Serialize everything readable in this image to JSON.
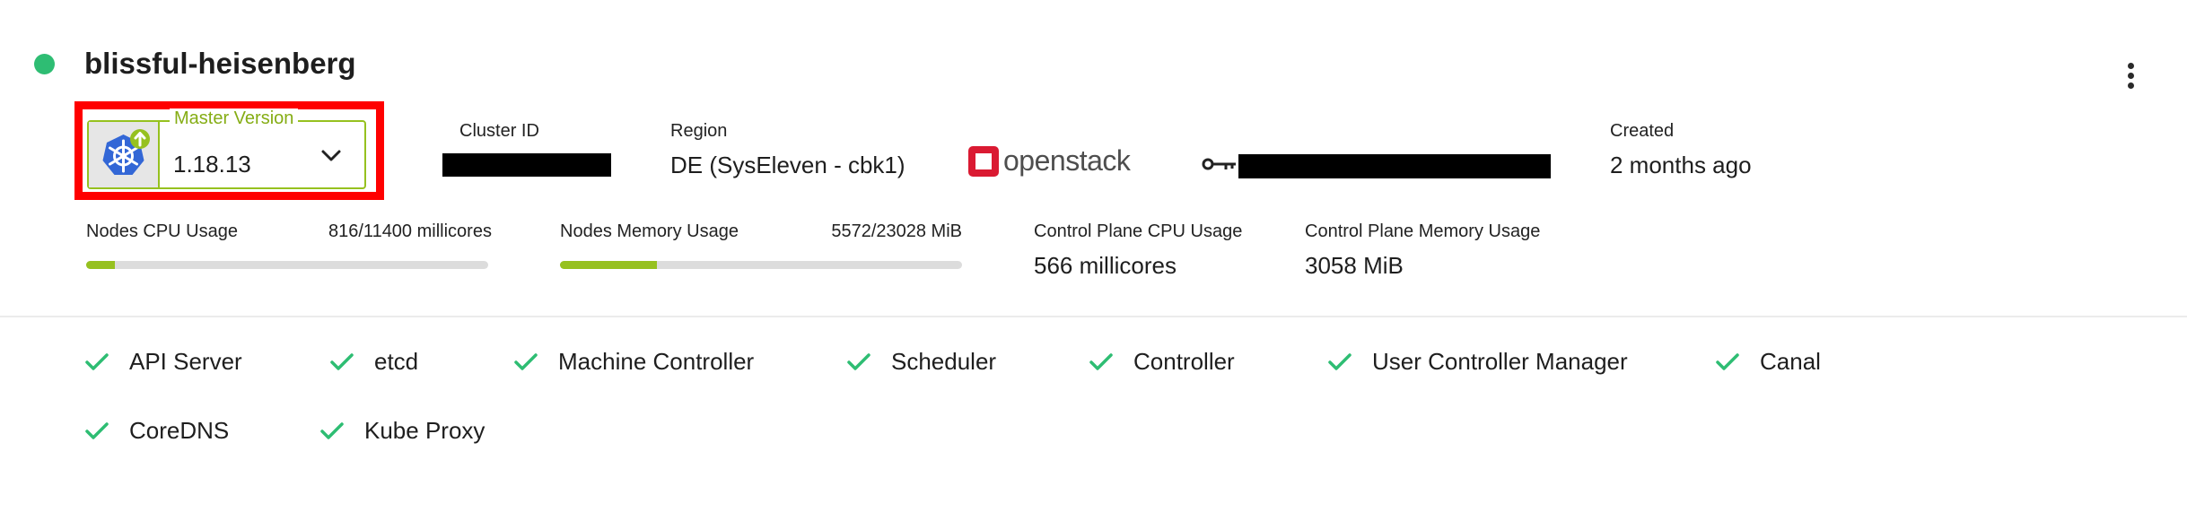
{
  "cluster": {
    "name": "blissful-heisenberg",
    "status_color": "#2ebd73"
  },
  "master_version": {
    "label": "Master Version",
    "value": "1.18.13"
  },
  "cluster_id": {
    "label": "Cluster ID"
  },
  "region": {
    "label": "Region",
    "value": "DE (SysEleven - cbk1)"
  },
  "provider": {
    "name": "openstack",
    "brand_color": "#da1a32"
  },
  "created": {
    "label": "Created",
    "value": "2 months ago"
  },
  "usage": {
    "nodes_cpu": {
      "label": "Nodes CPU Usage",
      "value": "816/11400 millicores",
      "fraction": 0.0716
    },
    "nodes_memory": {
      "label": "Nodes Memory Usage",
      "value": "5572/23028 MiB",
      "fraction": 0.242
    },
    "cp_cpu": {
      "label": "Control Plane CPU Usage",
      "value": "566 millicores"
    },
    "cp_memory": {
      "label": "Control Plane Memory Usage",
      "value": "3058 MiB"
    }
  },
  "health": [
    {
      "label": "API Server"
    },
    {
      "label": "etcd"
    },
    {
      "label": "Machine Controller"
    },
    {
      "label": "Scheduler"
    },
    {
      "label": "Controller"
    },
    {
      "label": "User Controller Manager"
    },
    {
      "label": "Canal"
    },
    {
      "label": "CoreDNS"
    },
    {
      "label": "Kube Proxy"
    }
  ],
  "colors": {
    "accent": "#96c11f",
    "check": "#2ebd73",
    "highlight": "#ff0000"
  },
  "icons": [
    "kubernetes-upgrade-icon",
    "chevron-down-icon",
    "key-icon",
    "check-icon",
    "more-vert-icon",
    "openstack-logo"
  ]
}
